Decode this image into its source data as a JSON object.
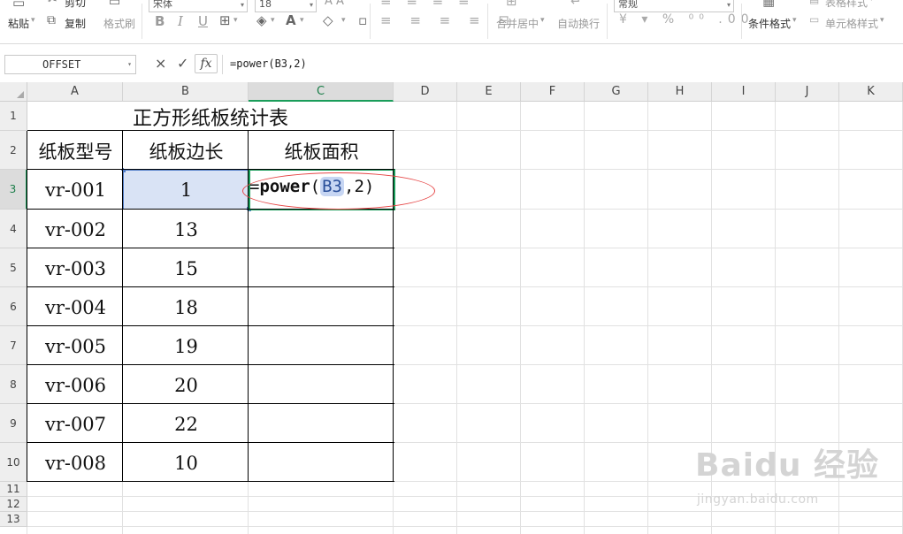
{
  "ribbon": {
    "paste_label": "粘贴",
    "cut_label": "剪切",
    "copy_label": "复制",
    "format_painter_label": "格式刷",
    "font_name": "宋体",
    "font_size": "18",
    "bold_label": "B",
    "italic_label": "I",
    "underline_label": "U",
    "merge_center_label": "合并居中",
    "wrap_text_label": "自动换行",
    "number_format": "常规",
    "conditional_format_label": "条件格式",
    "table_style_label": "表格样式",
    "cell_style_label": "单元格样式"
  },
  "formula_bar": {
    "name_box": "OFFSET",
    "cancel_icon": "×",
    "confirm_icon": "✓",
    "fx_label": "fx",
    "formula": "=power(B3,2)"
  },
  "columns": [
    "A",
    "B",
    "C",
    "D",
    "E",
    "F",
    "G",
    "H",
    "I",
    "J",
    "K"
  ],
  "rows": [
    "1",
    "2",
    "3",
    "4",
    "5",
    "6",
    "7",
    "8",
    "9",
    "10",
    "11",
    "12",
    "13"
  ],
  "table": {
    "title": "正方形纸板统计表",
    "headers": [
      "纸板型号",
      "纸板边长",
      "纸板面积"
    ],
    "records": [
      {
        "model": "vr-001",
        "side": "1"
      },
      {
        "model": "vr-002",
        "side": "13"
      },
      {
        "model": "vr-003",
        "side": "15"
      },
      {
        "model": "vr-004",
        "side": "18"
      },
      {
        "model": "vr-005",
        "side": "19"
      },
      {
        "model": "vr-006",
        "side": "20"
      },
      {
        "model": "vr-007",
        "side": "22"
      },
      {
        "model": "vr-008",
        "side": "10"
      }
    ]
  },
  "editing_cell": {
    "prefix": "=",
    "function": "power",
    "open_paren": "(",
    "reference": "B3",
    "rest": ",2)"
  },
  "watermark": {
    "brand": "Baidu 经验",
    "url": "jingyan.baidu.com"
  },
  "colors": {
    "active_green": "#1a9d5a",
    "selection_blue": "#d9e3f5",
    "annotation_red": "#e64646"
  }
}
